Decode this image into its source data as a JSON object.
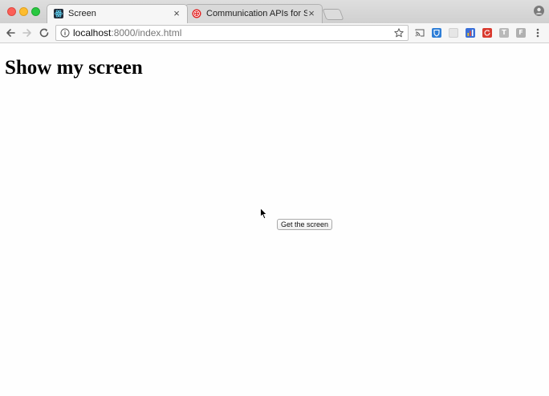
{
  "browser": {
    "tabs": [
      {
        "title": "Screen",
        "active": true
      },
      {
        "title": "Communication APIs for SMS, Voice,",
        "active": false
      }
    ],
    "address_bar": {
      "host": "localhost",
      "rest": ":8000/index.html"
    }
  },
  "page": {
    "heading": "Show my screen",
    "button_label": "Get the screen"
  },
  "colors": {
    "close_button": "#fc5f57",
    "minimize_button": "#fdbc2e",
    "maximize_button": "#28c840",
    "twilio_red": "#e22525",
    "page_background": "#fefefe"
  },
  "icons": {
    "back": "arrow-left-icon",
    "forward": "arrow-right-icon",
    "reload": "reload-icon",
    "info": "info-icon",
    "bookmark": "star-icon",
    "menu": "vertical-dots-icon"
  }
}
